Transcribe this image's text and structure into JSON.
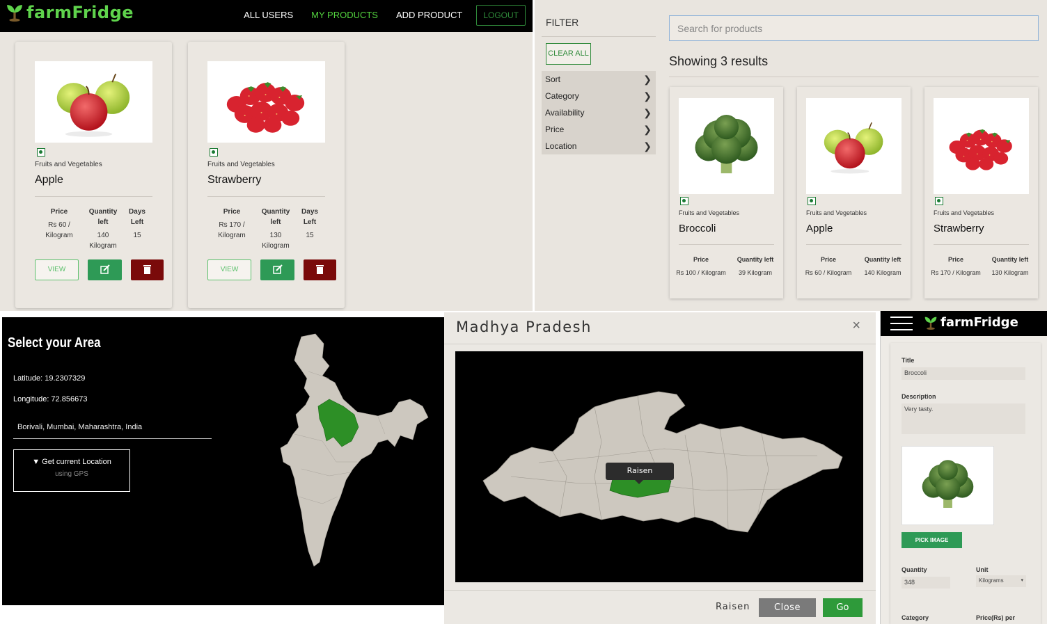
{
  "products_view": {
    "brand": "farmFridge",
    "nav": [
      "ALL USERS",
      "MY PRODUCTS",
      "ADD PRODUCT"
    ],
    "logout": "LOGOUT",
    "headers": {
      "price": "Price",
      "quantity": "Quantity left",
      "days": "Days Left"
    },
    "buttons": {
      "view": "VIEW"
    },
    "cards": [
      {
        "category": "Fruits and Vegetables",
        "name": "Apple",
        "price": "Rs 60 / Kilogram",
        "quantity": "140 Kilogram",
        "days": "15"
      },
      {
        "category": "Fruits and Vegetables",
        "name": "Strawberry",
        "price": "Rs 170 / Kilogram",
        "quantity": "130 Kilogram",
        "days": "15"
      }
    ]
  },
  "search_view": {
    "filter_title": "FILTER",
    "clear_all": "CLEAR ALL",
    "filters": [
      "Sort",
      "Category",
      "Availability",
      "Price",
      "Location"
    ],
    "search_placeholder": "Search for products",
    "results_text": "Showing 3 results",
    "headers": {
      "price": "Price",
      "quantity": "Quantity left"
    },
    "cards": [
      {
        "category": "Fruits and Vegetables",
        "name": "Broccoli",
        "price": "Rs 100 / Kilogram",
        "quantity": "39 Kilogram"
      },
      {
        "category": "Fruits and Vegetables",
        "name": "Apple",
        "price": "Rs 60 / Kilogram",
        "quantity": "140 Kilogram"
      },
      {
        "category": "Fruits and Vegetables",
        "name": "Strawberry",
        "price": "Rs 170 / Kilogram",
        "quantity": "130 Kilogram"
      }
    ]
  },
  "area_view": {
    "title": "Select your Area",
    "latitude": "Latitude: 19.2307329",
    "longitude": "Longitude: 72.856673",
    "address": "Borivali, Mumbai, Maharashtra, India",
    "gps_line1": "Get current Location",
    "gps_line2": "using GPS"
  },
  "state_modal": {
    "title": "Madhya Pradesh",
    "close_symbol": "×",
    "tooltip": "Raisen",
    "selected": "Raisen",
    "close_button": "Close",
    "go_button": "Go"
  },
  "add_form": {
    "brand": "farmFridge",
    "title_label": "Title",
    "title_value": "Broccoli",
    "desc_label": "Description",
    "desc_value": "Very tasty.",
    "pick_image": "PICK IMAGE",
    "qty_label": "Quantity",
    "qty_value": "348",
    "unit_label": "Unit",
    "unit_value": "Kilograms",
    "category_label": "Category",
    "price_label": "Price(Rs) per"
  },
  "colors": {
    "brand_green": "#5fd34c",
    "button_green": "#2e9a56",
    "delete_red": "#7a0a0a",
    "map_land": "#cdc8bf",
    "highlight": "#2d8f26"
  }
}
